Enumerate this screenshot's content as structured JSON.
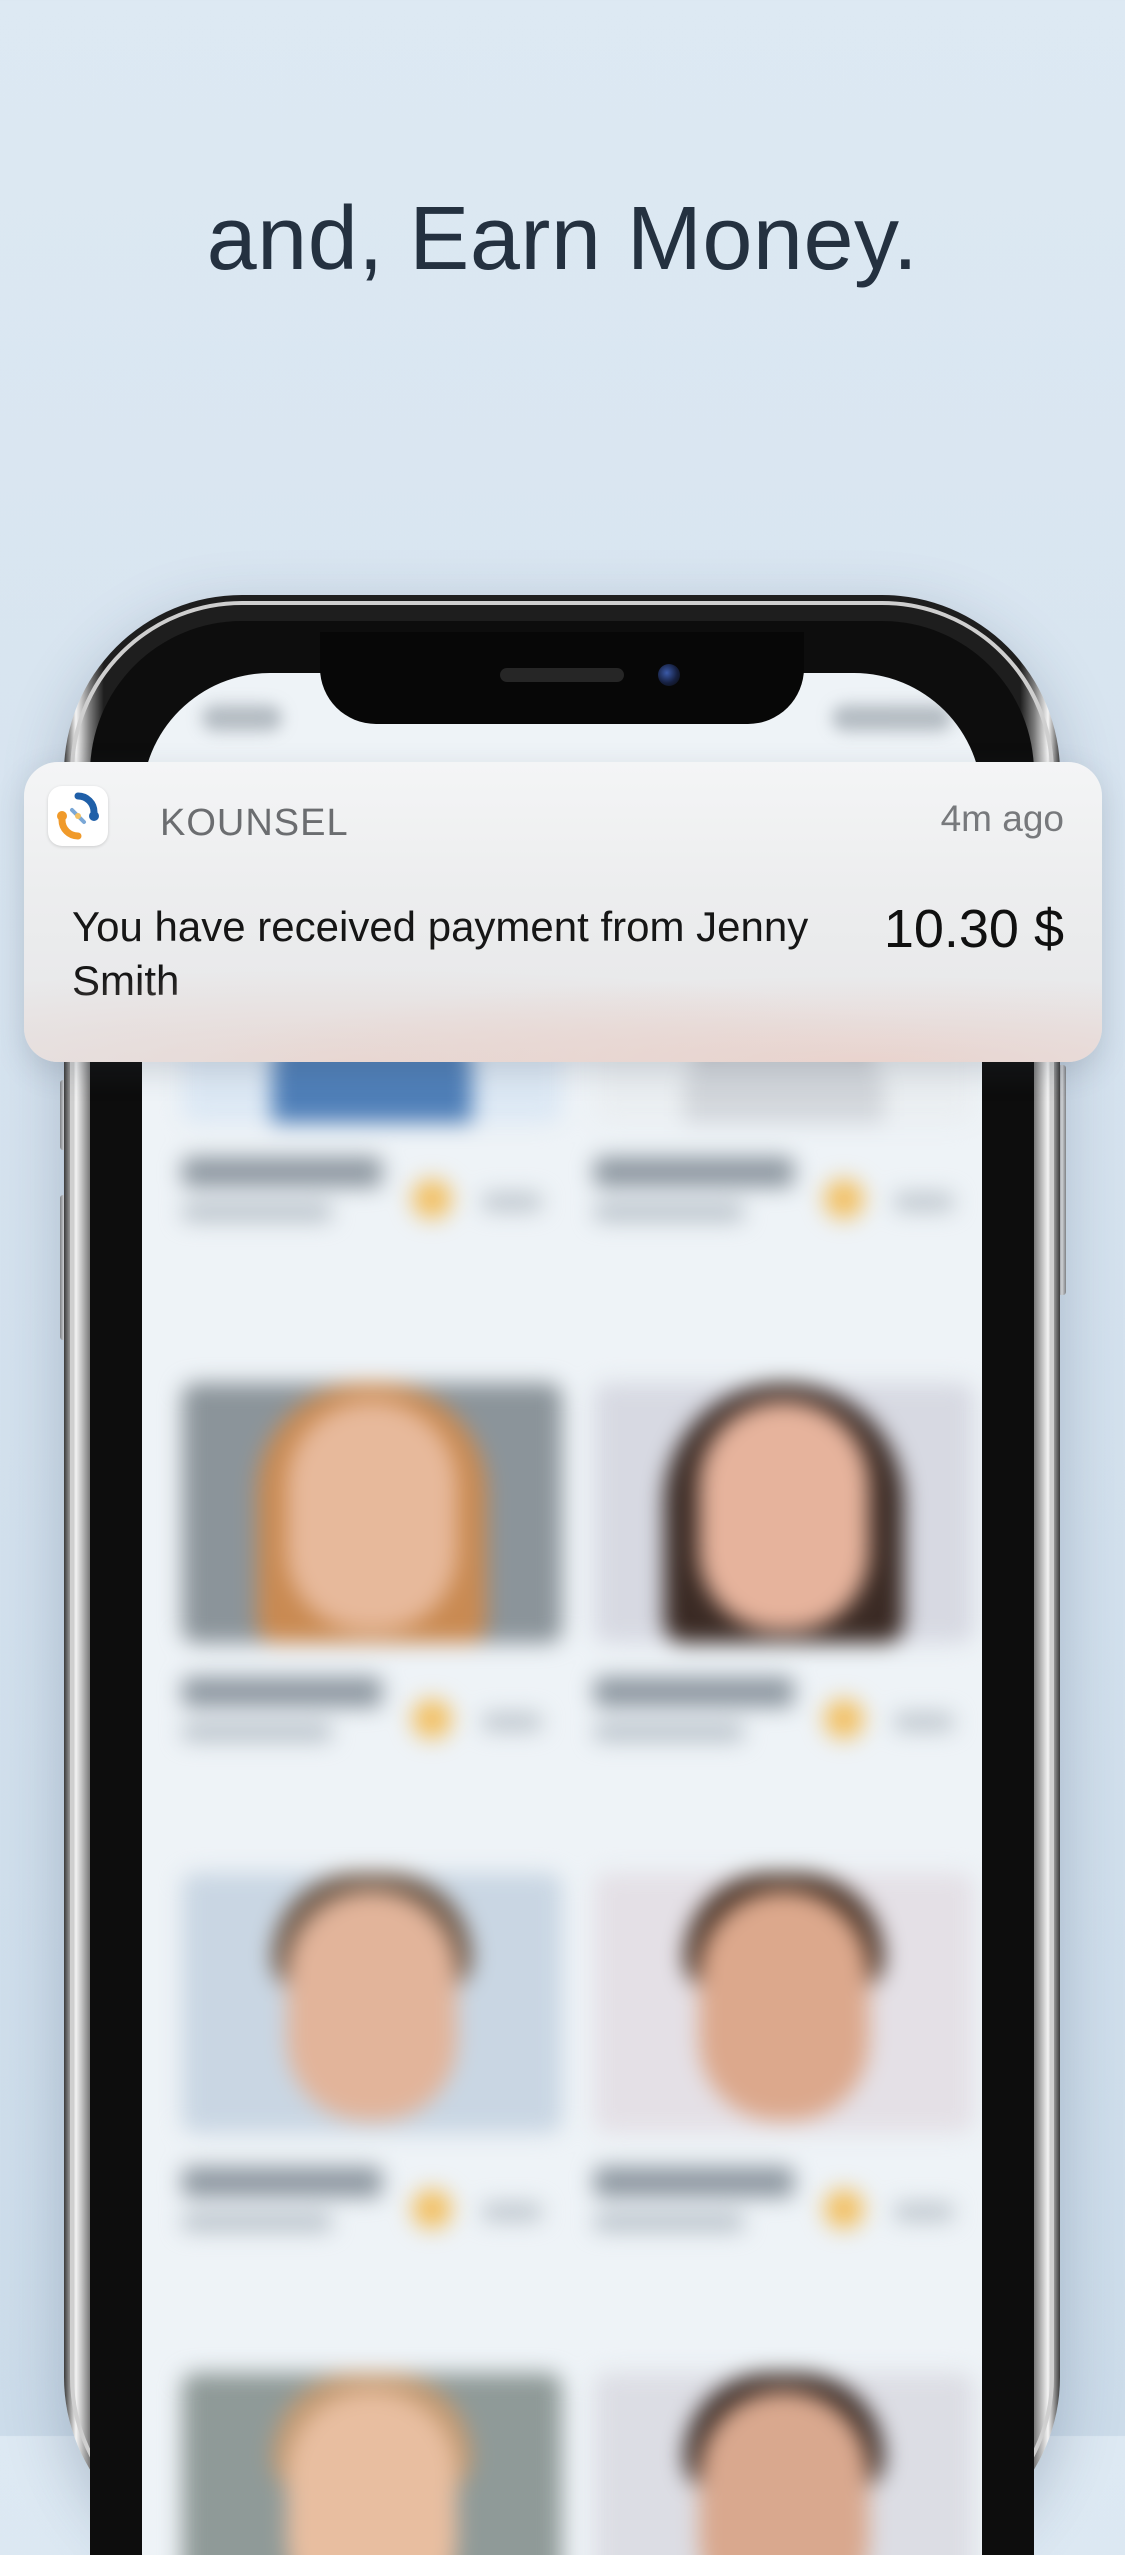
{
  "headline": "and, Earn Money.",
  "notification": {
    "app_name": "KOUNSEL",
    "time": "4m ago",
    "message": "You have received payment from Jenny Smith",
    "amount": "10.30 $",
    "app_icon": "kounsel-logo-icon"
  },
  "colors": {
    "background": "#dde9f3",
    "headline": "#243140",
    "star": "#f2c063",
    "logo_blue": "#1f5fa8",
    "logo_orange": "#f09a2a"
  }
}
